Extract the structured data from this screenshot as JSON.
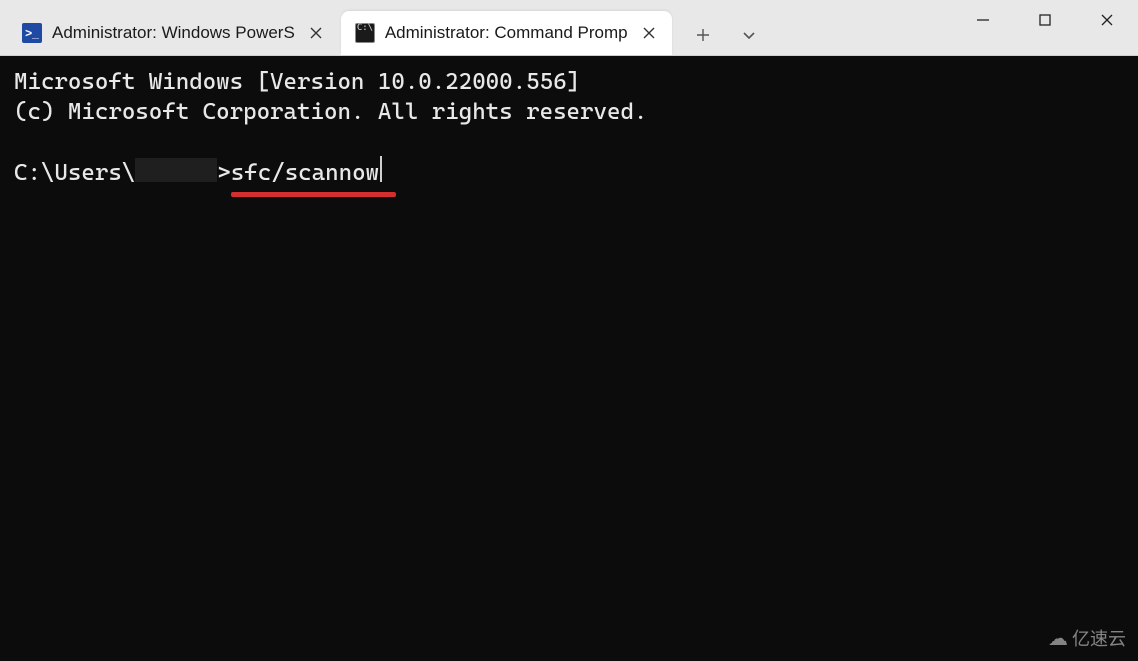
{
  "tabs": {
    "inactive": {
      "title": "Administrator: Windows PowerS",
      "icon_glyph": ">_"
    },
    "active": {
      "title": "Administrator: Command Promp",
      "icon_glyph": "C:\\"
    }
  },
  "terminal": {
    "line1": "Microsoft Windows [Version 10.0.22000.556]",
    "line2": "(c) Microsoft Corporation. All rights reserved.",
    "prompt_prefix": "C:\\Users\\",
    "prompt_gt": ">",
    "command": "sfc/scannow"
  },
  "watermark": {
    "text": "亿速云"
  }
}
